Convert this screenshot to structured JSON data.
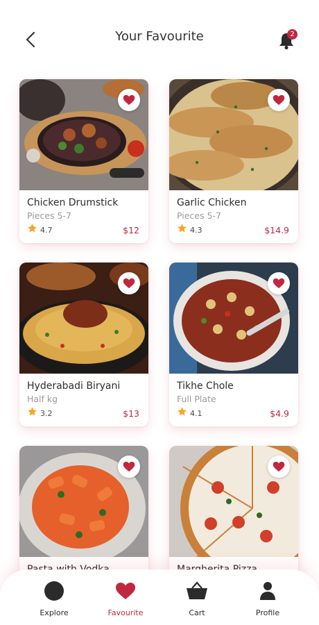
{
  "header": {
    "title": "Your Favourite",
    "notification_count": "2"
  },
  "items": [
    {
      "name": "Chicken Drumstick",
      "quantity": "Pieces 5-7",
      "rating": "4.7",
      "price": "$12"
    },
    {
      "name": "Garlic Chicken",
      "quantity": "Pieces 5-7",
      "rating": "4.3",
      "price": "$14.9"
    },
    {
      "name": "Hyderabadi Biryani",
      "quantity": "Half kg",
      "rating": "3.2",
      "price": "$13"
    },
    {
      "name": "Tikhe Chole",
      "quantity": "Full Plate",
      "rating": "4.1",
      "price": "$4.9"
    },
    {
      "name": "Pasta with Vodka",
      "quantity": "",
      "rating": "",
      "price": ""
    },
    {
      "name": "Margherita Pizza",
      "quantity": "",
      "rating": "",
      "price": ""
    }
  ],
  "bottom_nav": [
    {
      "label": "Explore",
      "icon": "explore-icon"
    },
    {
      "label": "Favourite",
      "icon": "heart-icon",
      "active": true
    },
    {
      "label": "Cart",
      "icon": "basket-icon"
    },
    {
      "label": "Profile",
      "icon": "person-icon"
    }
  ],
  "colors": {
    "accent": "#c0283f",
    "star": "#f5a623",
    "text": "#2d2d2d",
    "muted": "#9a9a9a"
  }
}
